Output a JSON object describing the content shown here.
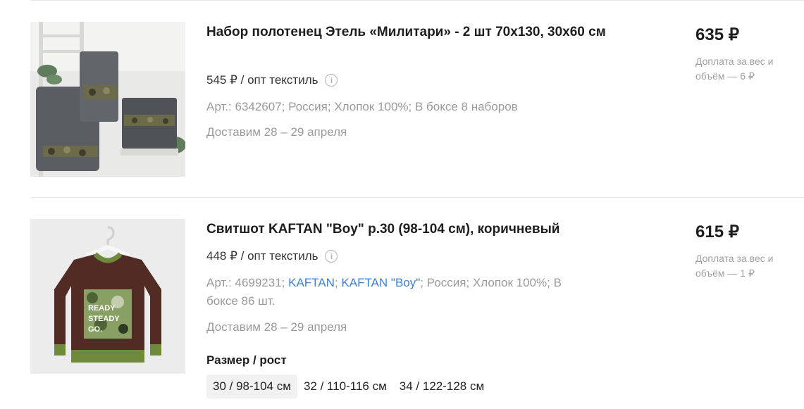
{
  "products": [
    {
      "title": "Набор полотенец Этель «Милитари» - 2 шт 70х130, 30х60 см",
      "opt_price": "545 ₽ / опт текстиль",
      "meta": "Арт.: 6342607; Россия; Хлопок 100%; В боксе 8 наборов",
      "delivery": "Доставим 28 – 29 апреля",
      "price": "635 ₽",
      "surcharge": "Доплата за вес и объём — 6 ₽"
    },
    {
      "title": "Свитшот KAFTAN \"Boy\" р.30 (98-104 см), коричневый",
      "opt_price": "448 ₽ / опт текстиль",
      "meta_prefix": "Арт.: 4699231; ",
      "meta_link1": "KAFTAN",
      "meta_sep": "; ",
      "meta_link2": "KAFTAN \"Boy\"",
      "meta_suffix": "; Россия; Хлопок 100%; В боксе 86 шт.",
      "delivery": "Доставим 28 – 29 апреля",
      "price": "615 ₽",
      "surcharge": "Доплата за вес и объём — 1 ₽",
      "size_label": "Размер / рост",
      "sizes": [
        "30 / 98-104 см",
        "32 / 110-116 см",
        "34 / 122-128 см"
      ],
      "selected_size": "30 / 98-104 см",
      "image_print_text": "READY STEADY GO"
    }
  ],
  "info_icon": "info-icon",
  "colors": {
    "link": "#3f7fd0",
    "muted": "#9a9a9a",
    "text": "#1e1e1e"
  }
}
